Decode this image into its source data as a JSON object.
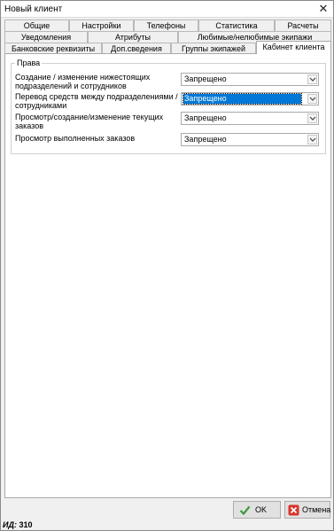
{
  "window": {
    "title": "Новый клиент"
  },
  "tabs": {
    "row1": [
      "Общие",
      "Настройки",
      "Телефоны",
      "Статистика",
      "Расчеты"
    ],
    "row2": [
      "Уведомления",
      "Атрибуты",
      "Любимые/нелюбимые экипажи"
    ],
    "row3": [
      "Банковские реквизиты",
      "Доп.сведения",
      "Группы экипажей",
      "Кабинет клиента"
    ],
    "active": "Кабинет клиента"
  },
  "rights": {
    "legend": "Права",
    "rows": [
      {
        "label": "Создание / изменение нижестоящих подразделений и сотрудников",
        "value": "Запрещено"
      },
      {
        "label": "Перевод средств между подразделениями / сотрудниками",
        "value": "Запрещено"
      },
      {
        "label": "Просмотр/создание/изменение текущих заказов",
        "value": "Запрещено"
      },
      {
        "label": "Просмотр выполненных заказов",
        "value": "Запрещено"
      }
    ]
  },
  "buttons": {
    "ok": "OK",
    "cancel": "Отмена"
  },
  "status": {
    "id_label": "ИД:",
    "id_value": "310"
  },
  "colors": {
    "selection": "#0078d7",
    "ok_check": "#3c9a3c",
    "cancel_x": "#d9342b"
  }
}
